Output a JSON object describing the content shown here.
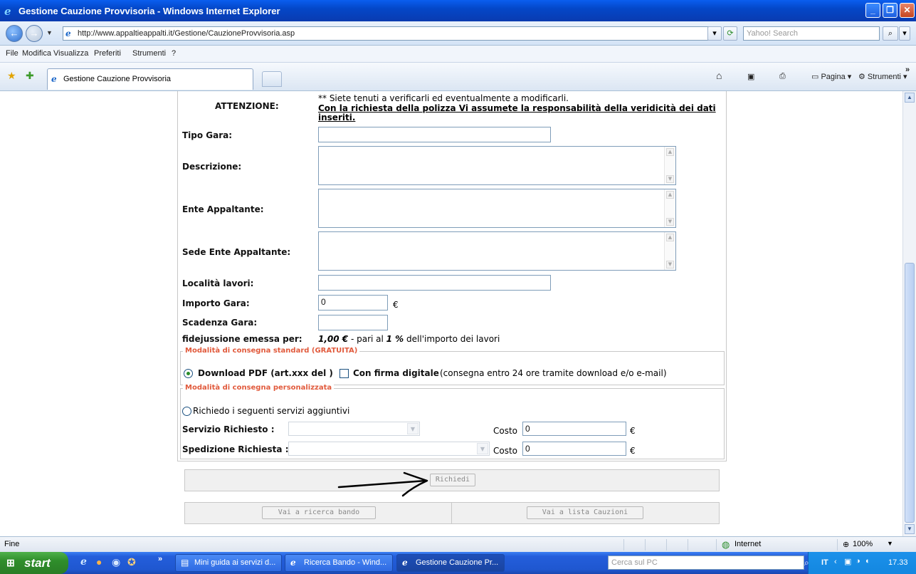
{
  "window": {
    "title": "Gestione Cauzione Provvisoria - Windows Internet Explorer",
    "url": "http://www.appaltieappalti.it/Gestione/CauzioneProvvisoria.asp",
    "search_placeholder": "Yahoo! Search"
  },
  "menu": [
    "File",
    "Modifica",
    "Visualizza",
    "Preferiti",
    "Strumenti",
    "?"
  ],
  "tab": {
    "label": "Gestione Cauzione Provvisoria"
  },
  "toolbar": {
    "pagina": "Pagina",
    "strumenti": "Strumenti"
  },
  "form": {
    "attention_label": "ATTENZIONE:",
    "attention_line1": "** Siete tenuti a verificarli ed eventualmente a modificarli.",
    "attention_line2": "Con la richiesta della polizza Vi assumete la responsabilità della veridicità dei dati",
    "attention_line3": "inseriti.",
    "tipo_gara_label": "Tipo Gara:",
    "descrizione_label": "Descrizione:",
    "ente_label": "Ente Appaltante:",
    "sede_label": "Sede Ente Appaltante:",
    "localita_label": "Località lavori:",
    "importo_label": "Importo Gara:",
    "importo_value": "0",
    "currency": "€",
    "scadenza_label": "Scadenza Gara:",
    "fidejussione_label": "fidejussione emessa per:",
    "fidejussione_amount": "1,00 €",
    "fidejussione_mid": " - pari al ",
    "fidejussione_pct": "1 %",
    "fidejussione_tail": " dell'importo dei lavori",
    "standard_legend": "Modalità di consegna standard (GRATUITA)",
    "download_pdf": "Download PDF (art.xxx del )",
    "firma_digitale": "Con firma digitale",
    "firma_note": "(consegna entro 24 ore tramite download e/o e-mail)",
    "custom_legend": "Modalità di consegna personalizzata",
    "richiedo_servizi": "Richiedo i seguenti servizi aggiuntivi",
    "servizio_label": "Servizio Richiesto :",
    "spedizione_label": "Spedizione Richiesta :",
    "costo_label": "Costo",
    "costo1_value": "0",
    "costo2_value": "0",
    "richiedi_button": "Richiedi",
    "ricerca_button": "Vai a ricerca bando",
    "lista_button": "Vai a lista Cauzioni"
  },
  "status": {
    "text": "Fine",
    "zone": "Internet",
    "zoom": "100%"
  },
  "taskbar": {
    "start": "start",
    "items": [
      "Mini guida ai servizi d...",
      "Ricerca Bando - Wind...",
      "Gestione Cauzione Pr..."
    ],
    "search_placeholder": "Cerca sul PC",
    "lang": "IT",
    "time": "17.33"
  }
}
